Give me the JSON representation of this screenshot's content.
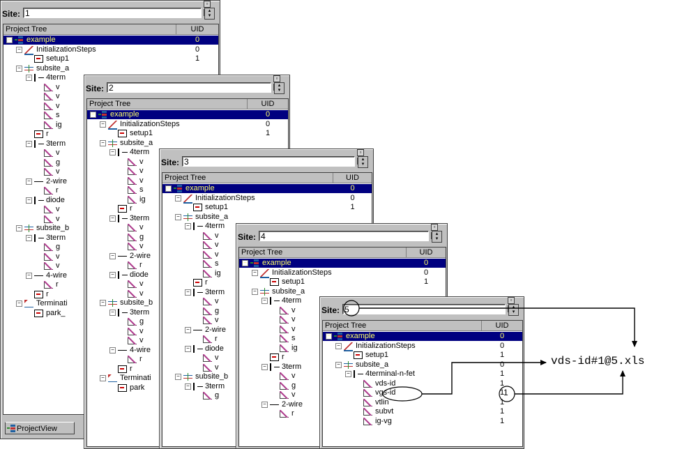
{
  "windows": [
    {
      "site_label": "Site:",
      "site_value": "1",
      "tree_header": "Project Tree",
      "uid_header": "UID",
      "tab_label": "ProjectView",
      "rows": [
        {
          "label": "example",
          "uid": "0",
          "icon": "project-icon",
          "selected": true
        },
        {
          "label": "InitializationSteps",
          "uid": "0",
          "icon": "init-steps-icon"
        },
        {
          "label": "setup1",
          "uid": "1",
          "icon": "setup-icon"
        },
        {
          "label": "subsite_a",
          "uid": "",
          "icon": "subsite-icon"
        },
        {
          "label": "4term",
          "uid": "",
          "icon": "device-icon"
        },
        {
          "label": "v",
          "uid": "",
          "icon": "measurement-icon"
        },
        {
          "label": "v",
          "uid": "",
          "icon": "measurement-icon"
        },
        {
          "label": "v",
          "uid": "",
          "icon": "measurement-icon"
        },
        {
          "label": "s",
          "uid": "",
          "icon": "measurement-icon"
        },
        {
          "label": "ig",
          "uid": "",
          "icon": "measurement-icon"
        },
        {
          "label": "r",
          "uid": "",
          "icon": "setup-icon"
        },
        {
          "label": "3term",
          "uid": "",
          "icon": "device-icon"
        },
        {
          "label": "v",
          "uid": "",
          "icon": "measurement-icon"
        },
        {
          "label": "g",
          "uid": "",
          "icon": "measurement-icon"
        },
        {
          "label": "v",
          "uid": "",
          "icon": "measurement-icon"
        },
        {
          "label": "2-wire",
          "uid": "",
          "icon": "resistor-icon"
        },
        {
          "label": "r",
          "uid": "",
          "icon": "measurement-icon"
        },
        {
          "label": "diode",
          "uid": "",
          "icon": "diode-icon"
        },
        {
          "label": "v",
          "uid": "",
          "icon": "measurement-icon"
        },
        {
          "label": "v",
          "uid": "",
          "icon": "measurement-icon"
        },
        {
          "label": "subsite_b",
          "uid": "",
          "icon": "subsite-icon"
        },
        {
          "label": "3term",
          "uid": "",
          "icon": "device-icon"
        },
        {
          "label": "g",
          "uid": "",
          "icon": "measurement-icon"
        },
        {
          "label": "v",
          "uid": "",
          "icon": "measurement-icon"
        },
        {
          "label": "v",
          "uid": "",
          "icon": "measurement-icon"
        },
        {
          "label": "4-wire",
          "uid": "",
          "icon": "resistor-icon"
        },
        {
          "label": "r",
          "uid": "",
          "icon": "measurement-icon"
        },
        {
          "label": "r",
          "uid": "",
          "icon": "setup-icon"
        },
        {
          "label": "Terminati",
          "uid": "",
          "icon": "termination-icon"
        },
        {
          "label": "park_",
          "uid": "",
          "icon": "setup-icon"
        }
      ]
    },
    {
      "site_label": "Site:",
      "site_value": "2",
      "tree_header": "Project Tree",
      "uid_header": "UID",
      "rows": [
        {
          "label": "example",
          "uid": "0",
          "icon": "project-icon",
          "selected": true
        },
        {
          "label": "InitializationSteps",
          "uid": "0",
          "icon": "init-steps-icon"
        },
        {
          "label": "setup1",
          "uid": "1",
          "icon": "setup-icon"
        },
        {
          "label": "subsite_a",
          "uid": "",
          "icon": "subsite-icon"
        },
        {
          "label": "4term",
          "uid": "",
          "icon": "device-icon"
        },
        {
          "label": "v",
          "uid": "",
          "icon": "measurement-icon"
        },
        {
          "label": "v",
          "uid": "",
          "icon": "measurement-icon"
        },
        {
          "label": "v",
          "uid": "",
          "icon": "measurement-icon"
        },
        {
          "label": "s",
          "uid": "",
          "icon": "measurement-icon"
        },
        {
          "label": "ig",
          "uid": "",
          "icon": "measurement-icon"
        },
        {
          "label": "r",
          "uid": "",
          "icon": "setup-icon"
        },
        {
          "label": "3term",
          "uid": "",
          "icon": "device-icon"
        },
        {
          "label": "v",
          "uid": "",
          "icon": "measurement-icon"
        },
        {
          "label": "g",
          "uid": "",
          "icon": "measurement-icon"
        },
        {
          "label": "v",
          "uid": "",
          "icon": "measurement-icon"
        },
        {
          "label": "2-wire",
          "uid": "",
          "icon": "resistor-icon"
        },
        {
          "label": "r",
          "uid": "",
          "icon": "measurement-icon"
        },
        {
          "label": "diode",
          "uid": "",
          "icon": "diode-icon"
        },
        {
          "label": "v",
          "uid": "",
          "icon": "measurement-icon"
        },
        {
          "label": "v",
          "uid": "",
          "icon": "measurement-icon"
        },
        {
          "label": "subsite_b",
          "uid": "",
          "icon": "subsite-icon"
        },
        {
          "label": "3term",
          "uid": "",
          "icon": "device-icon"
        },
        {
          "label": "g",
          "uid": "",
          "icon": "measurement-icon"
        },
        {
          "label": "v",
          "uid": "",
          "icon": "measurement-icon"
        },
        {
          "label": "v",
          "uid": "",
          "icon": "measurement-icon"
        },
        {
          "label": "4-wire",
          "uid": "",
          "icon": "resistor-icon"
        },
        {
          "label": "r",
          "uid": "",
          "icon": "measurement-icon"
        },
        {
          "label": "r",
          "uid": "",
          "icon": "setup-icon"
        },
        {
          "label": "Terminati",
          "uid": "",
          "icon": "termination-icon"
        },
        {
          "label": "park",
          "uid": "",
          "icon": "setup-icon"
        }
      ]
    },
    {
      "site_label": "Site:",
      "site_value": "3",
      "tree_header": "Project Tree",
      "uid_header": "UID",
      "rows": [
        {
          "label": "example",
          "uid": "0",
          "icon": "project-icon",
          "selected": true
        },
        {
          "label": "InitializationSteps",
          "uid": "0",
          "icon": "init-steps-icon"
        },
        {
          "label": "setup1",
          "uid": "1",
          "icon": "setup-icon"
        },
        {
          "label": "subsite_a",
          "uid": "",
          "icon": "subsite-icon"
        },
        {
          "label": "4term",
          "uid": "",
          "icon": "device-icon"
        },
        {
          "label": "v",
          "uid": "",
          "icon": "measurement-icon"
        },
        {
          "label": "v",
          "uid": "",
          "icon": "measurement-icon"
        },
        {
          "label": "v",
          "uid": "",
          "icon": "measurement-icon"
        },
        {
          "label": "s",
          "uid": "",
          "icon": "measurement-icon"
        },
        {
          "label": "ig",
          "uid": "",
          "icon": "measurement-icon"
        },
        {
          "label": "r",
          "uid": "",
          "icon": "setup-icon"
        },
        {
          "label": "3term",
          "uid": "",
          "icon": "device-icon"
        },
        {
          "label": "v",
          "uid": "",
          "icon": "measurement-icon"
        },
        {
          "label": "g",
          "uid": "",
          "icon": "measurement-icon"
        },
        {
          "label": "v",
          "uid": "",
          "icon": "measurement-icon"
        },
        {
          "label": "2-wire",
          "uid": "",
          "icon": "resistor-icon"
        },
        {
          "label": "r",
          "uid": "",
          "icon": "measurement-icon"
        },
        {
          "label": "diode",
          "uid": "",
          "icon": "diode-icon"
        },
        {
          "label": "v",
          "uid": "",
          "icon": "measurement-icon"
        },
        {
          "label": "v",
          "uid": "",
          "icon": "measurement-icon"
        },
        {
          "label": "subsite_b",
          "uid": "",
          "icon": "subsite-icon"
        },
        {
          "label": "3term",
          "uid": "",
          "icon": "device-icon"
        },
        {
          "label": "g",
          "uid": "",
          "icon": "measurement-icon"
        }
      ]
    },
    {
      "site_label": "Site:",
      "site_value": "4",
      "tree_header": "Project Tree",
      "uid_header": "UID",
      "rows": [
        {
          "label": "example",
          "uid": "0",
          "icon": "project-icon",
          "selected": true
        },
        {
          "label": "InitializationSteps",
          "uid": "0",
          "icon": "init-steps-icon"
        },
        {
          "label": "setup1",
          "uid": "1",
          "icon": "setup-icon"
        },
        {
          "label": "subsite_a",
          "uid": "",
          "icon": "subsite-icon"
        },
        {
          "label": "4term",
          "uid": "",
          "icon": "device-icon"
        },
        {
          "label": "v",
          "uid": "",
          "icon": "measurement-icon"
        },
        {
          "label": "v",
          "uid": "",
          "icon": "measurement-icon"
        },
        {
          "label": "v",
          "uid": "",
          "icon": "measurement-icon"
        },
        {
          "label": "s",
          "uid": "",
          "icon": "measurement-icon"
        },
        {
          "label": "ig",
          "uid": "",
          "icon": "measurement-icon"
        },
        {
          "label": "r",
          "uid": "",
          "icon": "setup-icon"
        },
        {
          "label": "3term",
          "uid": "",
          "icon": "device-icon"
        },
        {
          "label": "v",
          "uid": "",
          "icon": "measurement-icon"
        },
        {
          "label": "g",
          "uid": "",
          "icon": "measurement-icon"
        },
        {
          "label": "v",
          "uid": "",
          "icon": "measurement-icon"
        },
        {
          "label": "2-wire",
          "uid": "",
          "icon": "resistor-icon"
        },
        {
          "label": "r",
          "uid": "",
          "icon": "measurement-icon"
        }
      ]
    },
    {
      "site_label": "Site:",
      "site_value": "5",
      "tree_header": "Project Tree",
      "uid_header": "UID",
      "rows": [
        {
          "label": "example",
          "uid": "0",
          "icon": "project-icon",
          "selected": true
        },
        {
          "label": "InitializationSteps",
          "uid": "0",
          "icon": "init-steps-icon"
        },
        {
          "label": "setup1",
          "uid": "1",
          "icon": "setup-icon"
        },
        {
          "label": "subsite_a",
          "uid": "0",
          "icon": "subsite-icon"
        },
        {
          "label": "4terminal-n-fet",
          "uid": "1",
          "icon": "device-icon"
        },
        {
          "label": "vds-id",
          "uid": "1",
          "icon": "measurement-icon"
        },
        {
          "label": "vgs-id",
          "uid": "1",
          "icon": "measurement-icon"
        },
        {
          "label": "vtlin",
          "uid": "1",
          "icon": "measurement-icon"
        },
        {
          "label": "subvt",
          "uid": "1",
          "icon": "measurement-icon"
        },
        {
          "label": "ig-vg",
          "uid": "1",
          "icon": "measurement-icon"
        }
      ]
    }
  ],
  "annotation": {
    "output_file": "vds-id#1@5.xls",
    "callout_site": "5",
    "callout_uid": "1"
  }
}
